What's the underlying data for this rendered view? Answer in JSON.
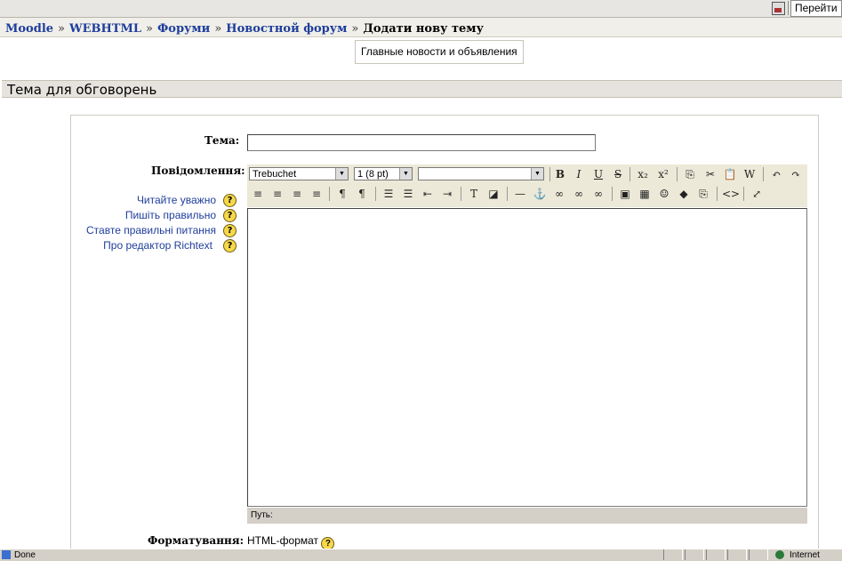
{
  "browser": {
    "goto_label": "Перейти",
    "status_text": "Done",
    "zone_text": "Internet"
  },
  "breadcrumb": {
    "items": [
      "Moodle",
      "WEBHTML",
      "Форуми",
      "Новостной форум"
    ],
    "separator": "»",
    "current": "Додати нову тему"
  },
  "tooltip": "Главные новости и объявления",
  "section_title": "Тема для обговорень",
  "form": {
    "subject_label": "Тема:",
    "subject_value": "",
    "message_label": "Повідомлення:",
    "help_links": [
      "Читайте уважно",
      "Пишіть правильно",
      "Ставте правильні питання",
      "Про редактор Richtext"
    ],
    "help_icon": "?",
    "format_label": "Форматування:",
    "format_value": "HTML-формат"
  },
  "editor": {
    "font_select": "Trebuchet",
    "size_select": "1 (8 pt)",
    "style_select": "",
    "path_label": "Путь:",
    "row1_icons": [
      "bold-icon",
      "italic-icon",
      "underline-icon",
      "strikethrough-icon",
      "subscript-icon",
      "superscript-icon",
      "copy-icon",
      "cut-icon",
      "paste-icon",
      "paste-word-icon",
      "undo-icon",
      "redo-icon"
    ],
    "row1_glyphs": [
      "B",
      "I",
      "U",
      "S",
      "x₂",
      "x²",
      "⎘",
      "✂",
      "📋",
      "W",
      "↶",
      "↷"
    ],
    "row2_icons": [
      "align-left-icon",
      "align-center-icon",
      "align-right-icon",
      "justify-icon",
      "ltr-icon",
      "rtl-icon",
      "ordered-list-icon",
      "unordered-list-icon",
      "outdent-icon",
      "indent-icon",
      "text-color-icon",
      "bg-color-icon",
      "horizontal-rule-icon",
      "anchor-icon",
      "link-icon",
      "unlink-icon",
      "nolink-icon",
      "image-icon",
      "table-icon",
      "smiley-icon",
      "special-char-icon",
      "search-replace-icon",
      "html-source-icon",
      "fullscreen-icon"
    ],
    "row2_glyphs": [
      "≡",
      "≡",
      "≡",
      "≡",
      "¶",
      "¶",
      "☰",
      "☰",
      "⇤",
      "⇥",
      "T",
      "◪",
      "—",
      "⚓",
      "∞",
      "∞",
      "∞",
      "▣",
      "▦",
      "☺",
      "◆",
      "⎘",
      "<>",
      "⤢"
    ]
  },
  "colors": {
    "link": "#1f3e9c",
    "toolbar_bg": "#ece9d8",
    "section_bg": "#e6e3de"
  }
}
